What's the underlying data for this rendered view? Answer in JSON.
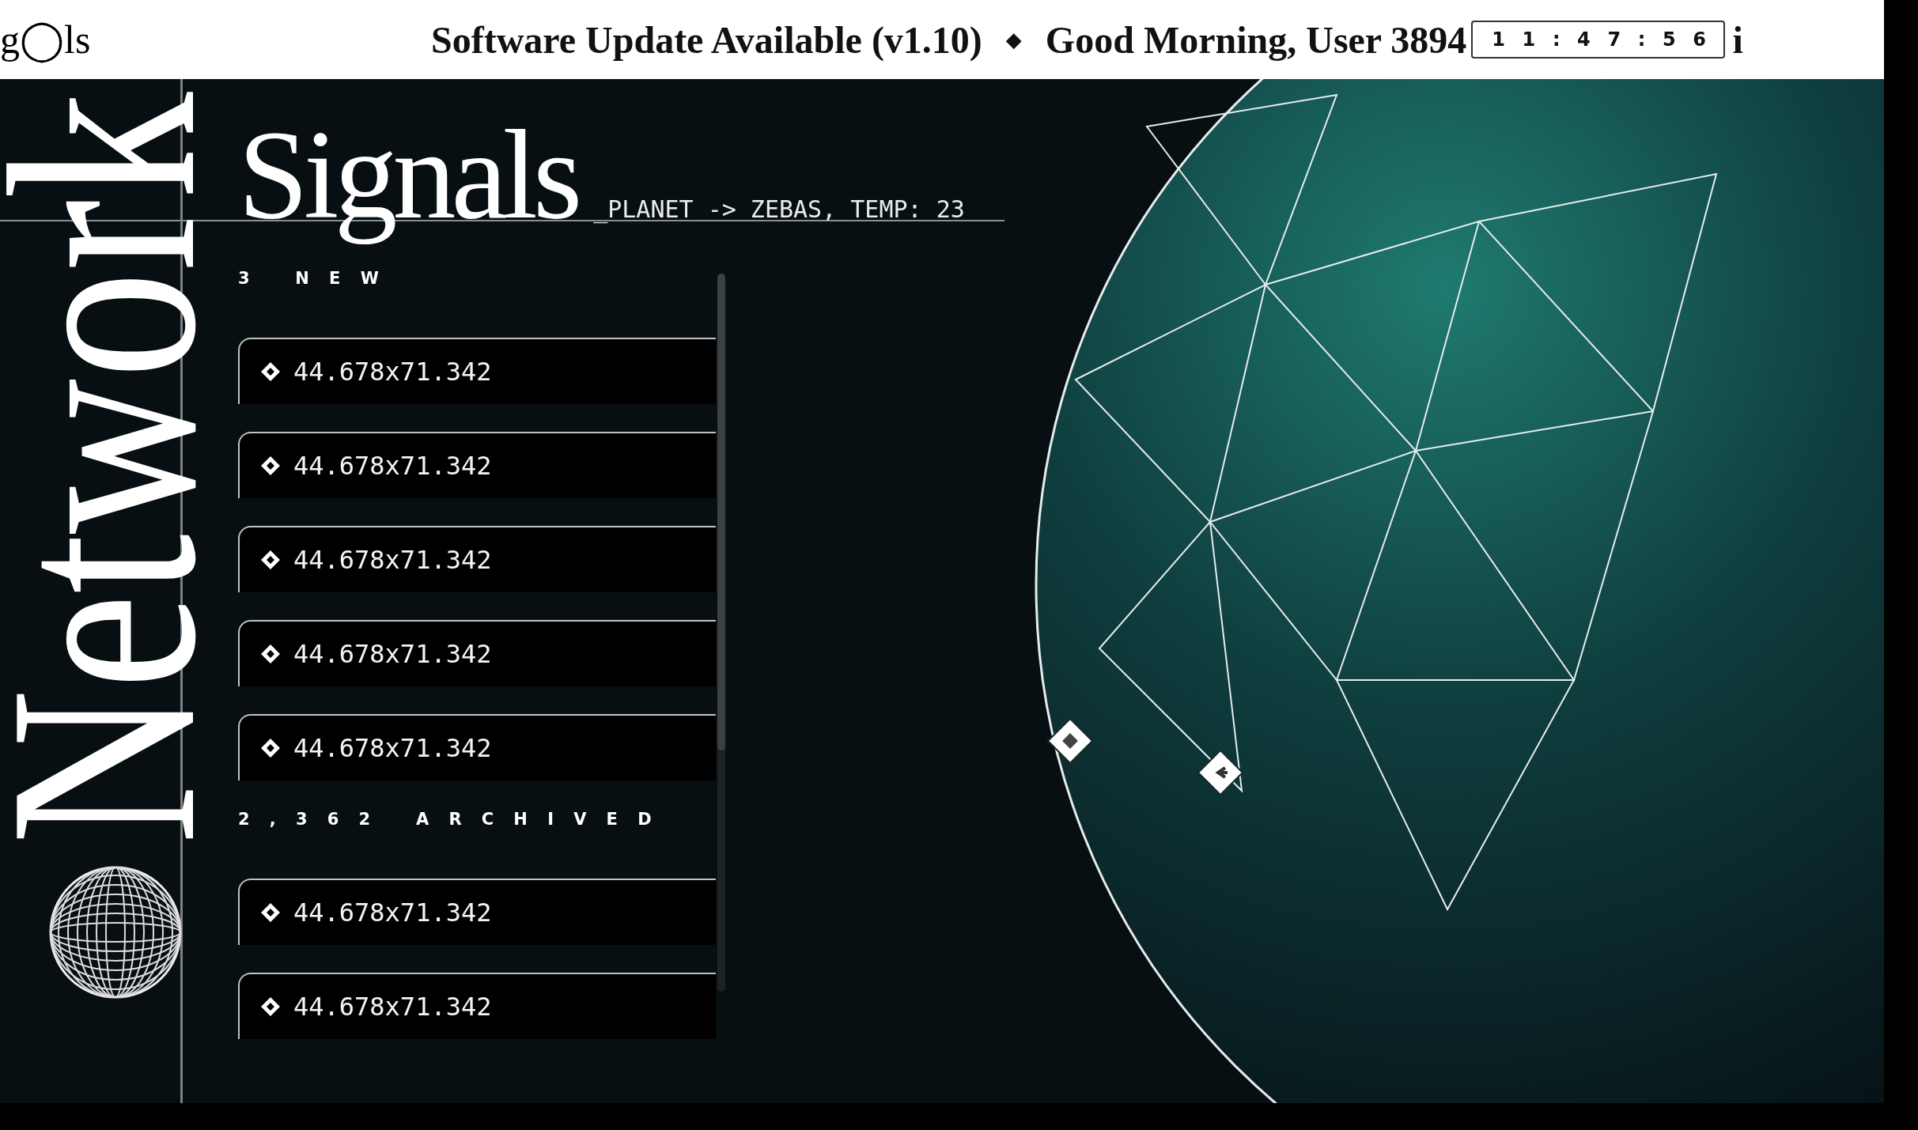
{
  "top_bar": {
    "logo": "g◯ls",
    "ticker": [
      "Software Update Available (v1.10)",
      "Good Morning, User 3894"
    ],
    "ticker_separator": "◆",
    "clock": "11:47:56",
    "ticker_tail": "i"
  },
  "side_title": "Network",
  "page": {
    "title": "Signals",
    "subtitle": "_PLANET -> ZEBAS, TEMP: 23"
  },
  "sections": [
    {
      "heading": "3 NEW",
      "items": [
        "44.678x71.342",
        "44.678x71.342",
        "44.678x71.342",
        "44.678x71.342",
        "44.678x71.342"
      ]
    },
    {
      "heading": "2,362 ARCHIVED",
      "items": [
        "44.678x71.342",
        "44.678x71.342"
      ]
    }
  ],
  "globe": {
    "kind": "picture",
    "markers": [
      {
        "kind": "dot"
      },
      {
        "kind": "arrow"
      }
    ]
  }
}
